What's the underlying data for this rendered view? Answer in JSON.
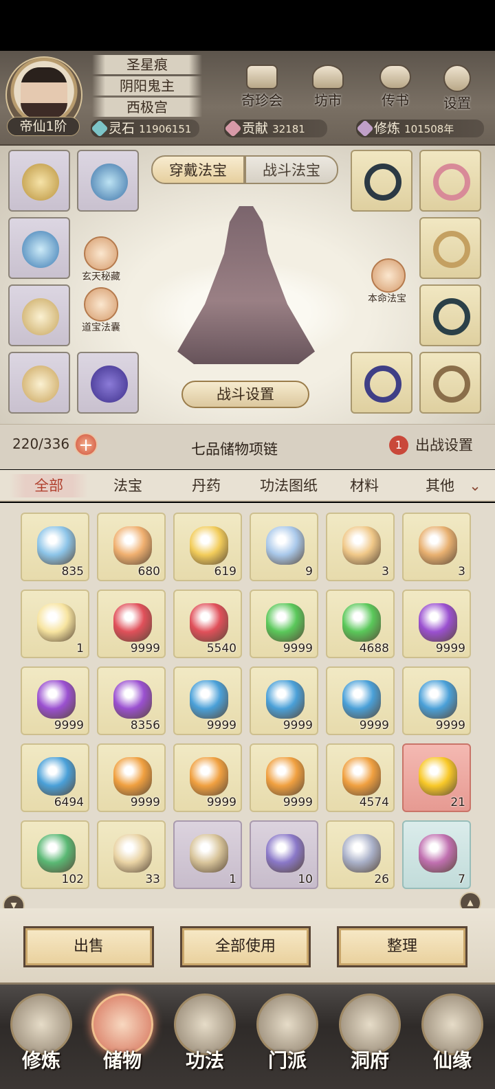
{
  "header": {
    "rank": "帝仙1阶",
    "titles": [
      "圣星痕",
      "阴阳鬼主",
      "西极宫"
    ],
    "nav": [
      {
        "label": "奇珍会",
        "icon": "treasure-pavilion-icon"
      },
      {
        "label": "坊市",
        "icon": "market-icon"
      },
      {
        "label": "传书",
        "icon": "scroll-mail-icon"
      },
      {
        "label": "设置",
        "icon": "gear-icon"
      }
    ],
    "resources": {
      "spirit_stone_label": "灵石",
      "spirit_stone_value": "11906151",
      "contribution_label": "贡献",
      "contribution_value": "32181",
      "cultivation_label": "修炼",
      "cultivation_value": "101508年"
    }
  },
  "equip": {
    "tabs": [
      "穿戴法宝",
      "战斗法宝"
    ],
    "side_buttons": [
      "玄天秘藏",
      "道宝法囊",
      "本命法宝"
    ],
    "battle_settings": "战斗设置"
  },
  "bag": {
    "capacity": "220/336",
    "name": "七品储物项链",
    "deploy_count": "1",
    "deploy_label": "出战设置"
  },
  "categories": [
    "全部",
    "法宝",
    "丹药",
    "功法图纸",
    "材料",
    "其他"
  ],
  "items": [
    {
      "count": "835",
      "color": "#8cc4e8",
      "frame": "gold"
    },
    {
      "count": "680",
      "color": "#f0b070",
      "frame": "gold"
    },
    {
      "count": "619",
      "color": "#f2cc5a",
      "frame": "gold"
    },
    {
      "count": "9",
      "color": "#a9c8ea",
      "frame": "gold"
    },
    {
      "count": "3",
      "color": "#f0c888",
      "frame": "gold"
    },
    {
      "count": "3",
      "color": "#e8b070",
      "frame": "gold"
    },
    {
      "count": "1",
      "color": "#f7e4a0",
      "frame": "gold"
    },
    {
      "count": "9999",
      "color": "#e0505a",
      "frame": "gold"
    },
    {
      "count": "5540",
      "color": "#e0505a",
      "frame": "gold"
    },
    {
      "count": "9999",
      "color": "#5ac85a",
      "frame": "gold"
    },
    {
      "count": "4688",
      "color": "#5ac85a",
      "frame": "gold"
    },
    {
      "count": "9999",
      "color": "#9a50d0",
      "frame": "gold"
    },
    {
      "count": "9999",
      "color": "#9a50d0",
      "frame": "gold"
    },
    {
      "count": "8356",
      "color": "#9a50d0",
      "frame": "gold"
    },
    {
      "count": "9999",
      "color": "#4aa0d8",
      "frame": "gold"
    },
    {
      "count": "9999",
      "color": "#4aa0d8",
      "frame": "gold"
    },
    {
      "count": "9999",
      "color": "#4aa0d8",
      "frame": "gold"
    },
    {
      "count": "9999",
      "color": "#4aa0d8",
      "frame": "gold"
    },
    {
      "count": "6494",
      "color": "#4aa0d8",
      "frame": "gold"
    },
    {
      "count": "9999",
      "color": "#f0a040",
      "frame": "gold"
    },
    {
      "count": "9999",
      "color": "#f0a040",
      "frame": "gold"
    },
    {
      "count": "9999",
      "color": "#f0a040",
      "frame": "gold"
    },
    {
      "count": "4574",
      "color": "#f0a040",
      "frame": "gold"
    },
    {
      "count": "21",
      "color": "#f8c828",
      "frame": "red"
    },
    {
      "count": "102",
      "color": "#5ab874",
      "frame": "gold"
    },
    {
      "count": "33",
      "color": "#e9d3a4",
      "frame": "gold"
    },
    {
      "count": "1",
      "color": "#d8c49a",
      "frame": "purple"
    },
    {
      "count": "10",
      "color": "#8a78c8",
      "frame": "purple"
    },
    {
      "count": "26",
      "color": "#a9b0c8",
      "frame": "gold"
    },
    {
      "count": "7",
      "color": "#c070b0",
      "frame": "teal"
    }
  ],
  "actions": [
    "出售",
    "全部使用",
    "整理"
  ],
  "bottom_nav": [
    "修炼",
    "储物",
    "功法",
    "门派",
    "洞府",
    "仙缘"
  ]
}
